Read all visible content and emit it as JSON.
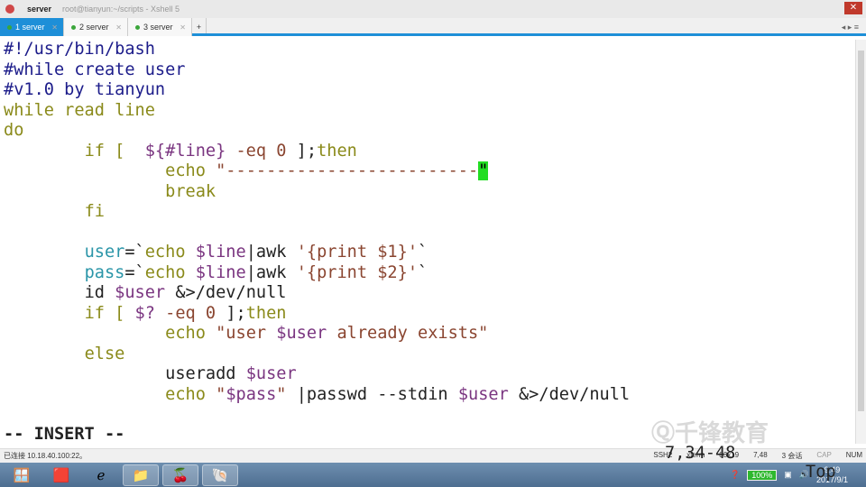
{
  "window": {
    "app_name": "server",
    "title": "root@tianyun:~/scripts - Xshell 5"
  },
  "tabs": [
    {
      "label": "1 server",
      "active": true
    },
    {
      "label": "2 server"
    },
    {
      "label": "3 server"
    }
  ],
  "new_tab": "+",
  "code_lines": [
    [
      [
        "#!/usr/bin/bash",
        "c"
      ]
    ],
    [
      [
        "#while create user",
        "c"
      ]
    ],
    [
      [
        "#v1.0 by tianyun",
        "c"
      ]
    ],
    [
      [
        "while read line",
        "k"
      ]
    ],
    [
      [
        "do",
        "k"
      ]
    ],
    [
      [
        "        ",
        ""
      ],
      [
        "if [  ",
        "k"
      ],
      [
        "${#line}",
        "v"
      ],
      [
        " -eq ",
        "s"
      ],
      [
        "0",
        "s"
      ],
      [
        " ];",
        "n"
      ],
      [
        "then",
        "k"
      ]
    ],
    [
      [
        "                ",
        ""
      ],
      [
        "echo ",
        "k"
      ],
      [
        "\"-------------------------",
        "s"
      ],
      [
        "\"",
        "cur"
      ]
    ],
    [
      [
        "                ",
        ""
      ],
      [
        "break",
        "k"
      ]
    ],
    [
      [
        "        ",
        ""
      ],
      [
        "fi",
        "k"
      ]
    ],
    [
      [
        "",
        ""
      ]
    ],
    [
      [
        "        ",
        ""
      ],
      [
        "user",
        "t"
      ],
      [
        "=`",
        "n"
      ],
      [
        "echo ",
        "k"
      ],
      [
        "$line",
        "v"
      ],
      [
        "|awk ",
        "n"
      ],
      [
        "'{print $1}'",
        "s"
      ],
      [
        "`",
        "n"
      ]
    ],
    [
      [
        "        ",
        ""
      ],
      [
        "pass",
        "t"
      ],
      [
        "=`",
        "n"
      ],
      [
        "echo ",
        "k"
      ],
      [
        "$line",
        "v"
      ],
      [
        "|awk ",
        "n"
      ],
      [
        "'{print $2}'",
        "s"
      ],
      [
        "`",
        "n"
      ]
    ],
    [
      [
        "        ",
        ""
      ],
      [
        "id ",
        "n"
      ],
      [
        "$user",
        "v"
      ],
      [
        " &>/dev/null",
        "n"
      ]
    ],
    [
      [
        "        ",
        ""
      ],
      [
        "if [ ",
        "k"
      ],
      [
        "$?",
        "v"
      ],
      [
        " -eq ",
        "s"
      ],
      [
        "0",
        "s"
      ],
      [
        " ];",
        "n"
      ],
      [
        "then",
        "k"
      ]
    ],
    [
      [
        "                ",
        ""
      ],
      [
        "echo ",
        "k"
      ],
      [
        "\"user ",
        "s"
      ],
      [
        "$user",
        "v"
      ],
      [
        " already exists\"",
        "s"
      ]
    ],
    [
      [
        "        ",
        ""
      ],
      [
        "else",
        "k"
      ]
    ],
    [
      [
        "                ",
        ""
      ],
      [
        "useradd ",
        "n"
      ],
      [
        "$user",
        "v"
      ]
    ],
    [
      [
        "                ",
        ""
      ],
      [
        "echo ",
        "k"
      ],
      [
        "\"",
        "s"
      ],
      [
        "$pass",
        "v"
      ],
      [
        "\"",
        "s"
      ],
      [
        " |passwd --stdin ",
        "n"
      ],
      [
        "$user",
        "v"
      ],
      [
        " &>/dev/null",
        "n"
      ]
    ]
  ],
  "vim_status": {
    "mode": "-- INSERT --",
    "position": "7,34-48",
    "scroll": "Top"
  },
  "statusbar": {
    "connection": "已连接 10.18.40.100:22。",
    "protocol": "SSH2",
    "term": "xterm",
    "size": "83x19",
    "cursor": "7,48",
    "sessions": "3 会话",
    "caps": "CAP",
    "num": "NUM"
  },
  "watermark": "千锋教育",
  "tray": {
    "battery": "100%",
    "time": "9:49",
    "date": "2017/9/1"
  }
}
